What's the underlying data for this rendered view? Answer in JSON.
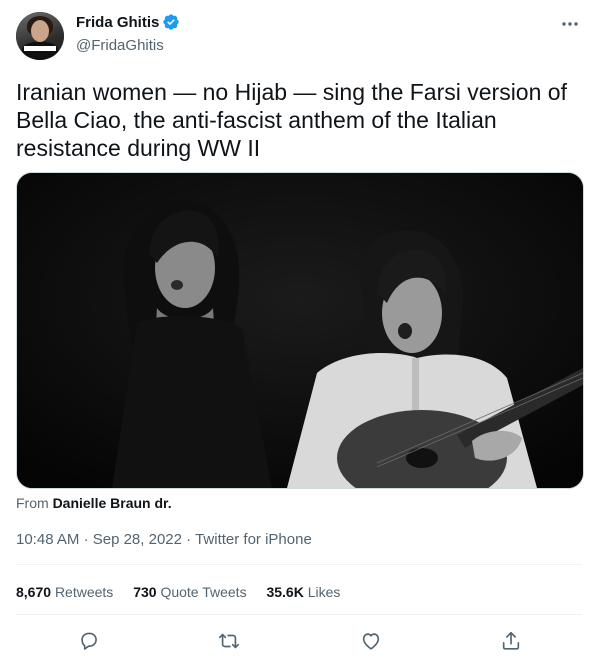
{
  "author": {
    "display_name": "Frida Ghitis",
    "handle": "@FridaGhitis",
    "verified": true,
    "avatar_icon": "profile-photo"
  },
  "tweet": {
    "text": "Iranian women — no Hijab — sing the Farsi version of Bella Ciao, the anti-fascist anthem of the Italian resistance during WW II"
  },
  "media": {
    "type": "video",
    "attribution_prefix": "From",
    "attribution_source": "Danielle Braun dr."
  },
  "meta": {
    "time": "10:48 AM",
    "separator": "·",
    "date": "Sep 28, 2022",
    "source": "Twitter for iPhone"
  },
  "stats": {
    "retweets_count": "8,670",
    "retweets_label": "Retweets",
    "quotes_count": "730",
    "quotes_label": "Quote Tweets",
    "likes_count": "35.6K",
    "likes_label": "Likes"
  },
  "actions": [
    "reply-icon",
    "retweet-icon",
    "like-icon",
    "share-icon"
  ],
  "colors": {
    "text": "#0f1419",
    "secondary": "#536471",
    "verified": "#1d9bf0",
    "border": "#eff3f4"
  }
}
